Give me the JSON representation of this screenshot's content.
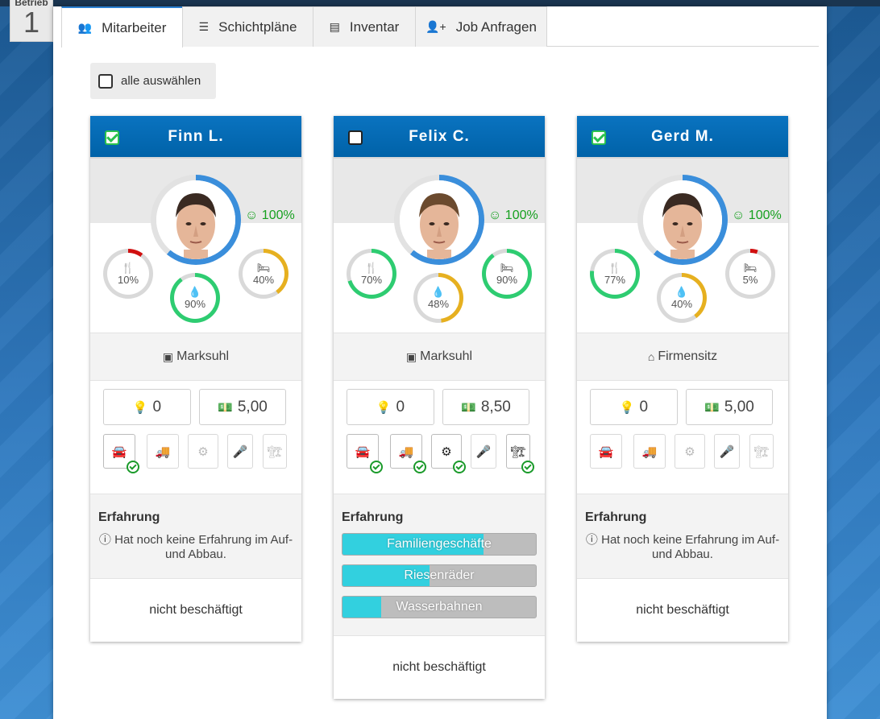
{
  "betrieb": {
    "label": "Betrieb",
    "number": "1"
  },
  "tabs": [
    {
      "label": "Mitarbeiter",
      "icon": "users-icon",
      "glyph": "👥",
      "active": true
    },
    {
      "label": "Schichtpläne",
      "icon": "list-icon",
      "glyph": "☰",
      "active": false
    },
    {
      "label": "Inventar",
      "icon": "archive-icon",
      "glyph": "▤",
      "active": false
    },
    {
      "label": "Job Anfragen",
      "icon": "user-plus-icon",
      "glyph": "👤+",
      "active": false
    }
  ],
  "select_all": {
    "label": "alle auswählen",
    "checked": false
  },
  "colors": {
    "header_blue": "#0068b0",
    "ring_blue": "#3a8edb",
    "good_green": "#2ecc71",
    "warn_yellow": "#e6b020",
    "bad_red": "#d01010",
    "exp_fill": "#32d0df"
  },
  "employees": [
    {
      "name": "Finn L.",
      "checked": true,
      "mood": "100%",
      "mood_icon": "smile-icon",
      "hunger": {
        "label": "10%",
        "value": 0.1
      },
      "thirst": {
        "label": "90%",
        "value": 0.9
      },
      "sleep": {
        "label": "40%",
        "value": 0.4
      },
      "location": "Marksuhl",
      "location_icon": "calendar-x-icon",
      "ideas": "0",
      "wage": "5,00",
      "skills": [
        {
          "name": "car",
          "on": true,
          "check": true
        },
        {
          "name": "truck",
          "on": false,
          "check": false
        },
        {
          "name": "gear",
          "on": false,
          "check": false
        },
        {
          "name": "mic",
          "on": false,
          "check": false
        },
        {
          "name": "crane",
          "on": false,
          "check": false
        }
      ],
      "experience_title": "Erfahrung",
      "experience_none": "Hat noch keine Erfahrung im Auf- und Abbau.",
      "experience": [],
      "status": "nicht beschäftigt"
    },
    {
      "name": "Felix C.",
      "checked": false,
      "mood": "100%",
      "mood_icon": "smile-icon",
      "hunger": {
        "label": "70%",
        "value": 0.7
      },
      "thirst": {
        "label": "48%",
        "value": 0.48
      },
      "sleep": {
        "label": "90%",
        "value": 0.9
      },
      "location": "Marksuhl",
      "location_icon": "calendar-x-icon",
      "ideas": "0",
      "wage": "8,50",
      "skills": [
        {
          "name": "car",
          "on": true,
          "check": true
        },
        {
          "name": "truck",
          "on": true,
          "check": true
        },
        {
          "name": "gear",
          "on": true,
          "check": true
        },
        {
          "name": "mic",
          "on": false,
          "check": false
        },
        {
          "name": "crane",
          "on": true,
          "check": true
        }
      ],
      "experience_title": "Erfahrung",
      "experience_none": "",
      "experience": [
        {
          "label": "Familiengeschäfte",
          "value": 0.73
        },
        {
          "label": "Riesenräder",
          "value": 0.45
        },
        {
          "label": "Wasserbahnen",
          "value": 0.2
        }
      ],
      "status": "nicht beschäftigt"
    },
    {
      "name": "Gerd M.",
      "checked": true,
      "mood": "100%",
      "mood_icon": "smile-icon",
      "hunger": {
        "label": "77%",
        "value": 0.77
      },
      "thirst": {
        "label": "40%",
        "value": 0.4
      },
      "sleep": {
        "label": "5%",
        "value": 0.05
      },
      "location": "Firmensitz",
      "location_icon": "home-icon",
      "ideas": "0",
      "wage": "5,00",
      "skills": [
        {
          "name": "car",
          "on": false,
          "check": false
        },
        {
          "name": "truck",
          "on": false,
          "check": false
        },
        {
          "name": "gear",
          "on": false,
          "check": false
        },
        {
          "name": "mic",
          "on": false,
          "check": false
        },
        {
          "name": "crane",
          "on": false,
          "check": false
        }
      ],
      "experience_title": "Erfahrung",
      "experience_none": "Hat noch keine Erfahrung im Auf- und Abbau.",
      "experience": [],
      "status": "nicht beschäftigt"
    }
  ]
}
